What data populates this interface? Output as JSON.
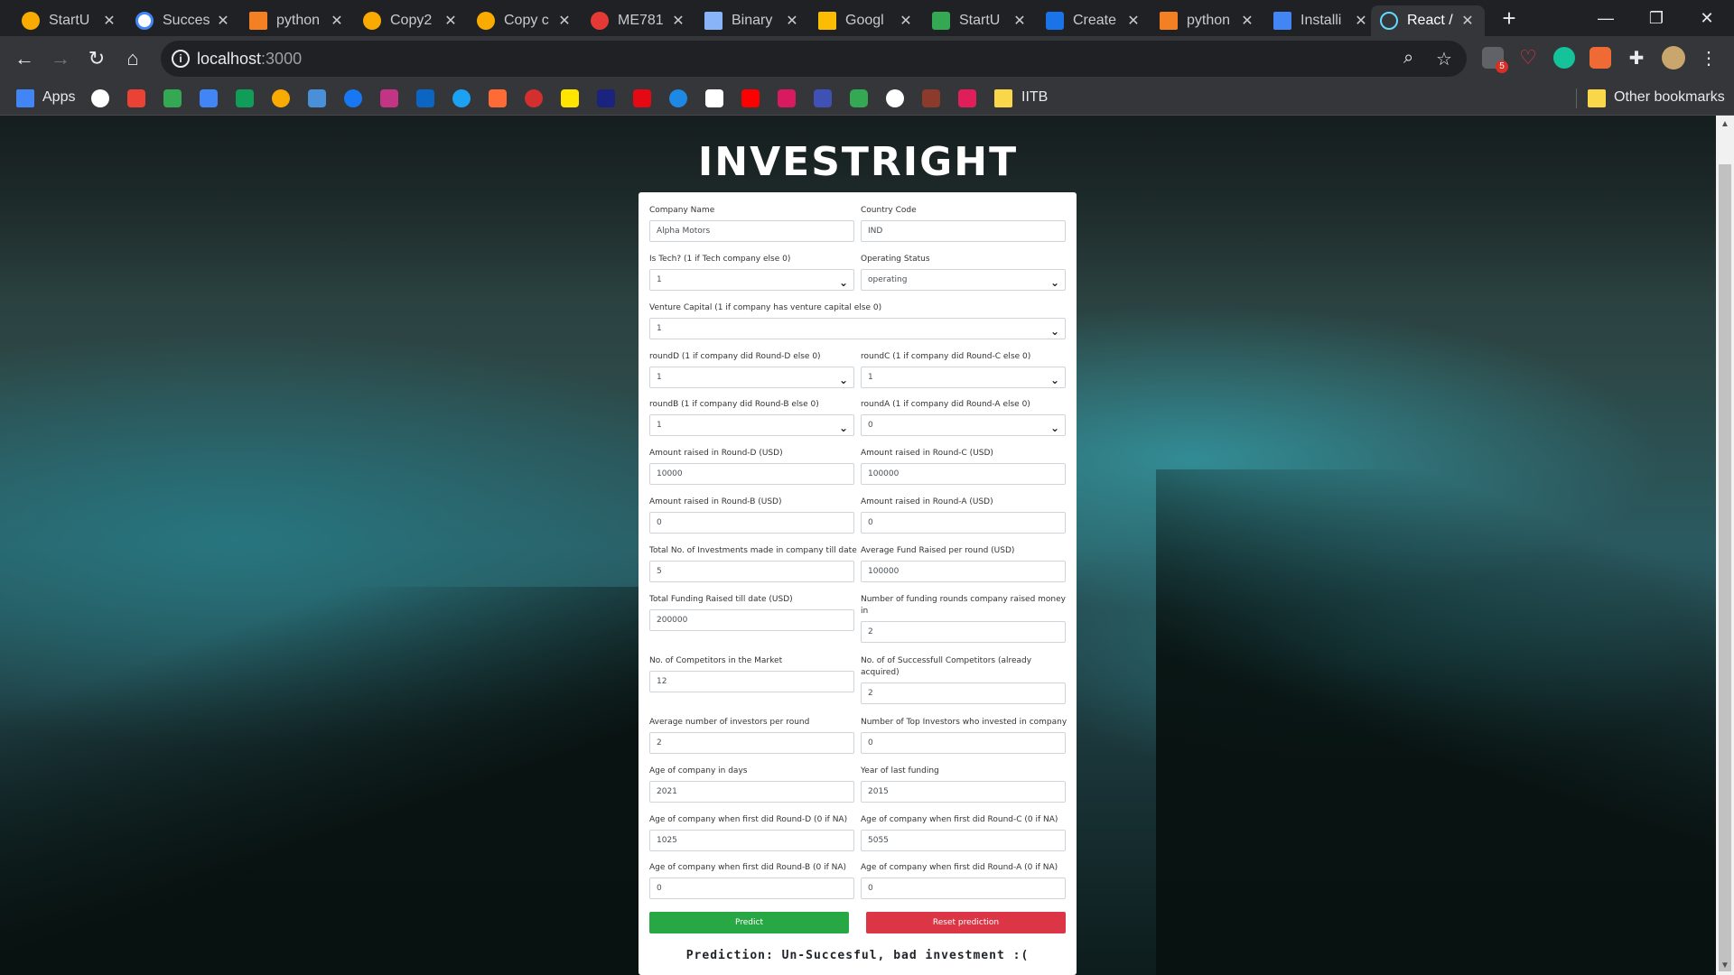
{
  "browser": {
    "tabs": [
      {
        "label": "StartU",
        "color": "#f9ab00"
      },
      {
        "label": "Succes",
        "color": "#ffffff"
      },
      {
        "label": "python",
        "color": "#f48024"
      },
      {
        "label": "Copy2",
        "color": "#f9ab00"
      },
      {
        "label": "Copy c",
        "color": "#f9ab00"
      },
      {
        "label": "ME781",
        "color": "#e53935"
      },
      {
        "label": "Binary",
        "color": "#8ab4f8"
      },
      {
        "label": "Googl",
        "color": "#fbbc04"
      },
      {
        "label": "StartU",
        "color": "#34a853"
      },
      {
        "label": "Create",
        "color": "#1a73e8"
      },
      {
        "label": "python",
        "color": "#f48024"
      },
      {
        "label": "Installi",
        "color": "#4285f4"
      },
      {
        "label": "React /",
        "color": "#61dafb"
      }
    ],
    "new_tab": "+",
    "url_host": "localhost",
    "url_port": ":3000",
    "bookmarks_apps": "Apps",
    "bookmarks_folder": "IITB",
    "other_bookmarks": "Other bookmarks",
    "extension_badge": "5"
  },
  "app": {
    "title": "INVESTRIGHT",
    "predict_label": "Predict",
    "reset_label": "Reset prediction",
    "prediction_text": "Prediction: Un-Succesful, bad investment :("
  },
  "form": {
    "company_name": {
      "label": "Company Name",
      "value": "Alpha Motors"
    },
    "country_code": {
      "label": "Country Code",
      "value": "IND"
    },
    "is_tech": {
      "label": "Is Tech? (1 if Tech company else 0)",
      "value": "1"
    },
    "operating_status": {
      "label": "Operating Status",
      "value": "operating"
    },
    "venture_capital": {
      "label": "Venture Capital (1 if company has venture capital else 0)",
      "value": "1"
    },
    "round_d": {
      "label": "roundD (1 if company did Round-D else 0)",
      "value": "1"
    },
    "round_c": {
      "label": "roundC (1 if company did Round-C else 0)",
      "value": "1"
    },
    "round_b": {
      "label": "roundB (1 if company did Round-B else 0)",
      "value": "1"
    },
    "round_a": {
      "label": "roundA (1 if company did Round-A else 0)",
      "value": "0"
    },
    "amount_d": {
      "label": "Amount raised in Round-D (USD)",
      "value": "10000"
    },
    "amount_c": {
      "label": "Amount raised in Round-C (USD)",
      "value": "100000"
    },
    "amount_b": {
      "label": "Amount raised in Round-B (USD)",
      "value": "0"
    },
    "amount_a": {
      "label": "Amount raised in Round-A (USD)",
      "value": "0"
    },
    "total_investments": {
      "label": "Total No. of Investments made in company till date",
      "value": "5"
    },
    "avg_fund": {
      "label": "Average Fund Raised per round (USD)",
      "value": "100000"
    },
    "total_funding": {
      "label": "Total Funding Raised till date (USD)",
      "value": "200000"
    },
    "num_rounds": {
      "label": "Number of funding rounds company raised money in",
      "value": "2"
    },
    "competitors": {
      "label": "No. of Competitors in the Market",
      "value": "12"
    },
    "successful_competitors": {
      "label": "No. of of Successfull Competitors (already acquired)",
      "value": "2"
    },
    "avg_investors": {
      "label": "Average number of investors per round",
      "value": "2"
    },
    "top_investors": {
      "label": "Number of Top Investors who invested in company",
      "value": "0"
    },
    "age_days": {
      "label": "Age of company in days",
      "value": "2021"
    },
    "year_last_funding": {
      "label": "Year of last funding",
      "value": "2015"
    },
    "age_first_d": {
      "label": "Age of company when first did Round-D (0 if NA)",
      "value": "1025"
    },
    "age_first_c": {
      "label": "Age of company when first did Round-C (0 if NA)",
      "value": "5055"
    },
    "age_first_b": {
      "label": "Age of company when first did Round-B (0 if NA)",
      "value": "0"
    },
    "age_first_a": {
      "label": "Age of company when first did Round-A (0 if NA)",
      "value": "0"
    }
  }
}
